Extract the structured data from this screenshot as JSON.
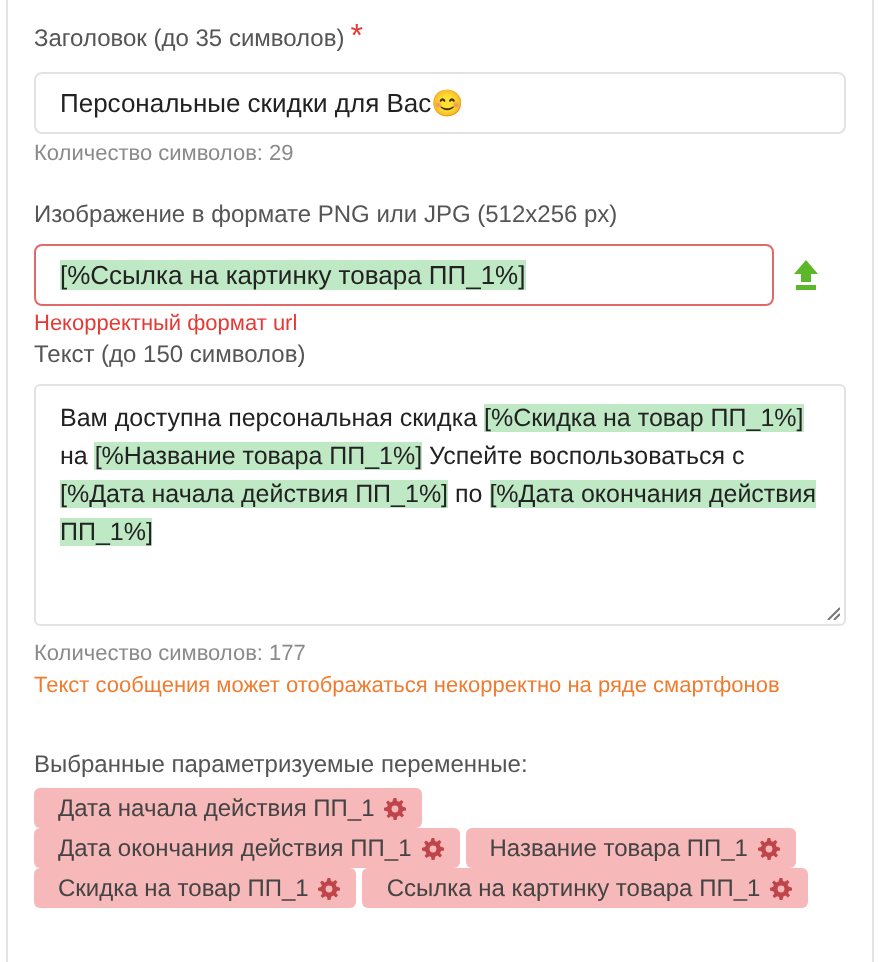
{
  "title_field": {
    "label": "Заголовок (до 35 символов)",
    "required_mark": "*",
    "value": "Персональные скидки для Вас😊",
    "counter": "Количество символов: 29"
  },
  "image_field": {
    "label": "Изображение в формате PNG или JPG (512x256 px)",
    "value": "[%Ссылка на картинку товара ПП_1%]",
    "invalid": true,
    "error": "Некорректный формат url"
  },
  "text_field": {
    "label": "Текст (до 150 символов)",
    "segments": [
      {
        "kind": "plain",
        "text": "Вам доступна персональная скидка "
      },
      {
        "kind": "variable",
        "text": "[%Скидка на товар ПП_1%]"
      },
      {
        "kind": "plain",
        "text": " на "
      },
      {
        "kind": "variable",
        "text": "[%Название товара ПП_1%]"
      },
      {
        "kind": "plain",
        "text": " Успейте воспользоваться с "
      },
      {
        "kind": "variable",
        "text": "[%Дата начала действия ПП_1%]"
      },
      {
        "kind": "plain",
        "text": " по "
      },
      {
        "kind": "variable",
        "text": "[%Дата окончания действия ПП_1%]"
      }
    ],
    "counter": "Количество символов: 177",
    "warning": "Текст сообщения может отображаться некорректно на ряде смартфонов"
  },
  "variables": {
    "label": "Выбранные параметризуемые переменные:",
    "items": [
      {
        "label": "Дата начала действия ПП_1"
      },
      {
        "label": "Дата окончания действия ПП_1"
      },
      {
        "label": "Название товара ПП_1"
      },
      {
        "label": "Скидка на товар ПП_1"
      },
      {
        "label": "Ссылка на картинку товара ПП_1"
      }
    ]
  }
}
